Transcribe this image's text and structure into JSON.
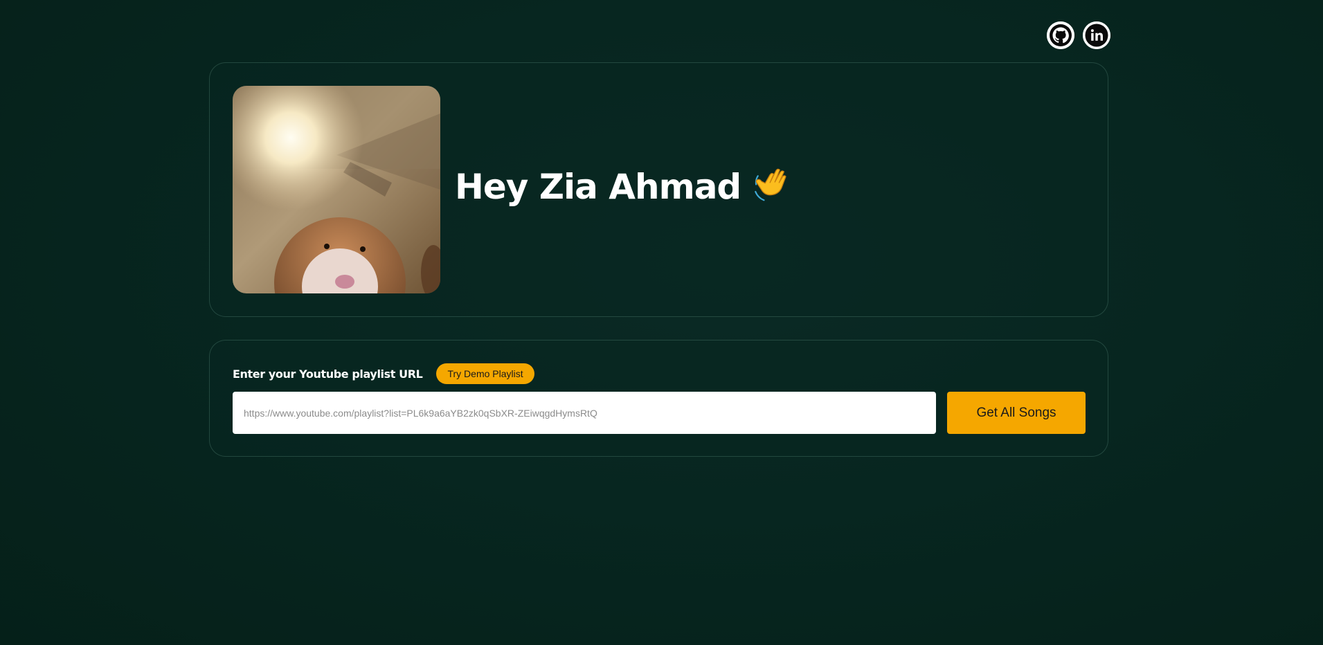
{
  "header": {
    "links": [
      {
        "icon": "github-icon",
        "label": "GitHub"
      },
      {
        "icon": "linkedin-icon",
        "label": "LinkedIn"
      }
    ]
  },
  "profile": {
    "greeting": "Hey Zia Ahmad",
    "greeting_emoji": "waving-hand-icon",
    "avatar": "hamster-photo"
  },
  "playlist_form": {
    "label": "Enter your Youtube playlist URL",
    "demo_button": "Try Demo Playlist",
    "input_placeholder": "https://www.youtube.com/playlist?list=PL6k9a6aYB2zk0qSbXR-ZEiwqgdHymsRtQ",
    "input_value": "",
    "submit_button": "Get All Songs"
  },
  "colors": {
    "accent": "#f5a700",
    "background": "#062520",
    "card_border": "#2f4f47"
  }
}
